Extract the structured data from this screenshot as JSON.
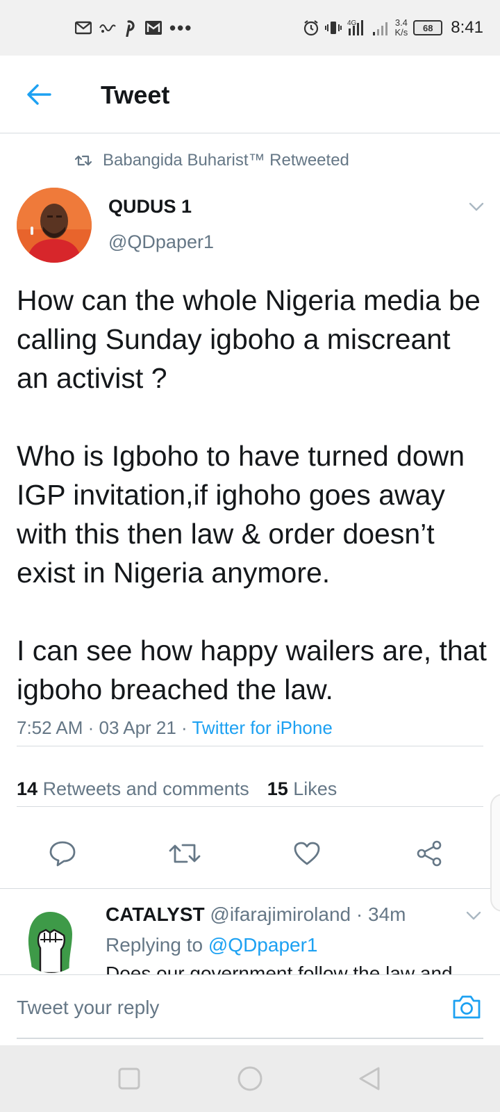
{
  "status_bar": {
    "speed_value": "3.4",
    "speed_unit": "K/s",
    "network": "4G",
    "battery": "68",
    "time": "8:41"
  },
  "header": {
    "title": "Tweet"
  },
  "retweet_context": {
    "text": "Babangida Buharist™ Retweeted"
  },
  "tweet": {
    "author_name": "QUDUS 1",
    "author_handle": "@QDpaper1",
    "text": "How can the whole Nigeria media be calling Sunday igboho a miscreant an activist ?\n\nWho is Igboho to have turned down IGP invitation,if ighoho goes away with this then law & order doesn’t exist in Nigeria anymore.\n\nI can see how happy wailers are, that igboho breached the law.",
    "time": "7:52 AM",
    "date": "03 Apr 21",
    "separator": " · ",
    "source": "Twitter for iPhone",
    "retweets_count": "14",
    "retweets_label": "Retweets and comments",
    "likes_count": "15",
    "likes_label": "Likes"
  },
  "reply": {
    "name": "CATALYST",
    "handle": "@ifarajimiroland",
    "time": "· 34m",
    "replying_label": "Replying to",
    "replying_to": "@QDpaper1",
    "text": "Does our government follow the law and"
  },
  "composer": {
    "placeholder": "Tweet your reply"
  },
  "colors": {
    "accent": "#1da1f2",
    "secondary_text": "#657786",
    "divider": "#d6dbdf",
    "nigeria_green": "#3e9a48"
  },
  "icons": {
    "back": "arrow-left-icon",
    "retweet_context": "retweet-icon",
    "caret": "chevron-down-icon",
    "reply": "comment-icon",
    "retweet": "retweet-icon",
    "like": "heart-icon",
    "share": "share-icon",
    "camera": "camera-icon"
  }
}
